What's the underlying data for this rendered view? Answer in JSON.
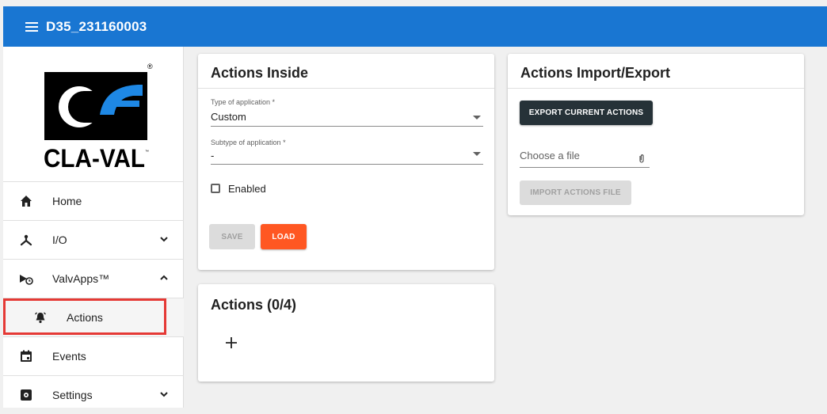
{
  "header": {
    "title": "D35_231160003"
  },
  "sidebar": {
    "logo_text": "CLA-VAL",
    "items": [
      {
        "label": "Home",
        "icon": "home-icon"
      },
      {
        "label": "I/O",
        "icon": "io-icon",
        "chevron": "down"
      },
      {
        "label": "ValvApps™",
        "icon": "valvapps-icon",
        "chevron": "up"
      },
      {
        "label": "Actions",
        "icon": "alarm-bell-icon"
      },
      {
        "label": "Events",
        "icon": "calendar-icon"
      },
      {
        "label": "Settings",
        "icon": "settings-icon",
        "chevron": "down"
      }
    ]
  },
  "actions_inside": {
    "title": "Actions Inside",
    "type_label": "Type of application *",
    "type_value": "Custom",
    "subtype_label": "Subtype of application *",
    "subtype_value": "-",
    "enabled_label": "Enabled",
    "save_label": "SAVE",
    "load_label": "LOAD"
  },
  "actions_list": {
    "title": "Actions (0/4)"
  },
  "import_export": {
    "title": "Actions Import/Export",
    "export_label": "EXPORT CURRENT ACTIONS",
    "file_placeholder": "Choose a file",
    "import_label": "IMPORT ACTIONS FILE"
  },
  "colors": {
    "header_bg": "#1976d2",
    "load_button": "#ff5722",
    "export_button": "#263238",
    "highlight_border": "#e53935"
  }
}
